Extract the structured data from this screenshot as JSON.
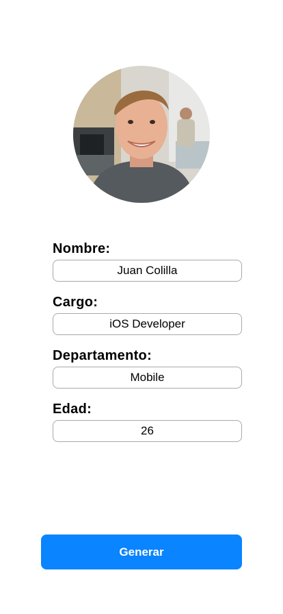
{
  "profile": {
    "avatar_icon": "profile-photo"
  },
  "form": {
    "fields": [
      {
        "label": "Nombre:",
        "value": "Juan Colilla"
      },
      {
        "label": "Cargo:",
        "value": "iOS Developer"
      },
      {
        "label": "Departamento:",
        "value": "Mobile"
      },
      {
        "label": "Edad:",
        "value": "26"
      }
    ]
  },
  "actions": {
    "generate_label": "Generar"
  },
  "colors": {
    "accent": "#0a84ff",
    "input_border": "#a8a8a8"
  }
}
